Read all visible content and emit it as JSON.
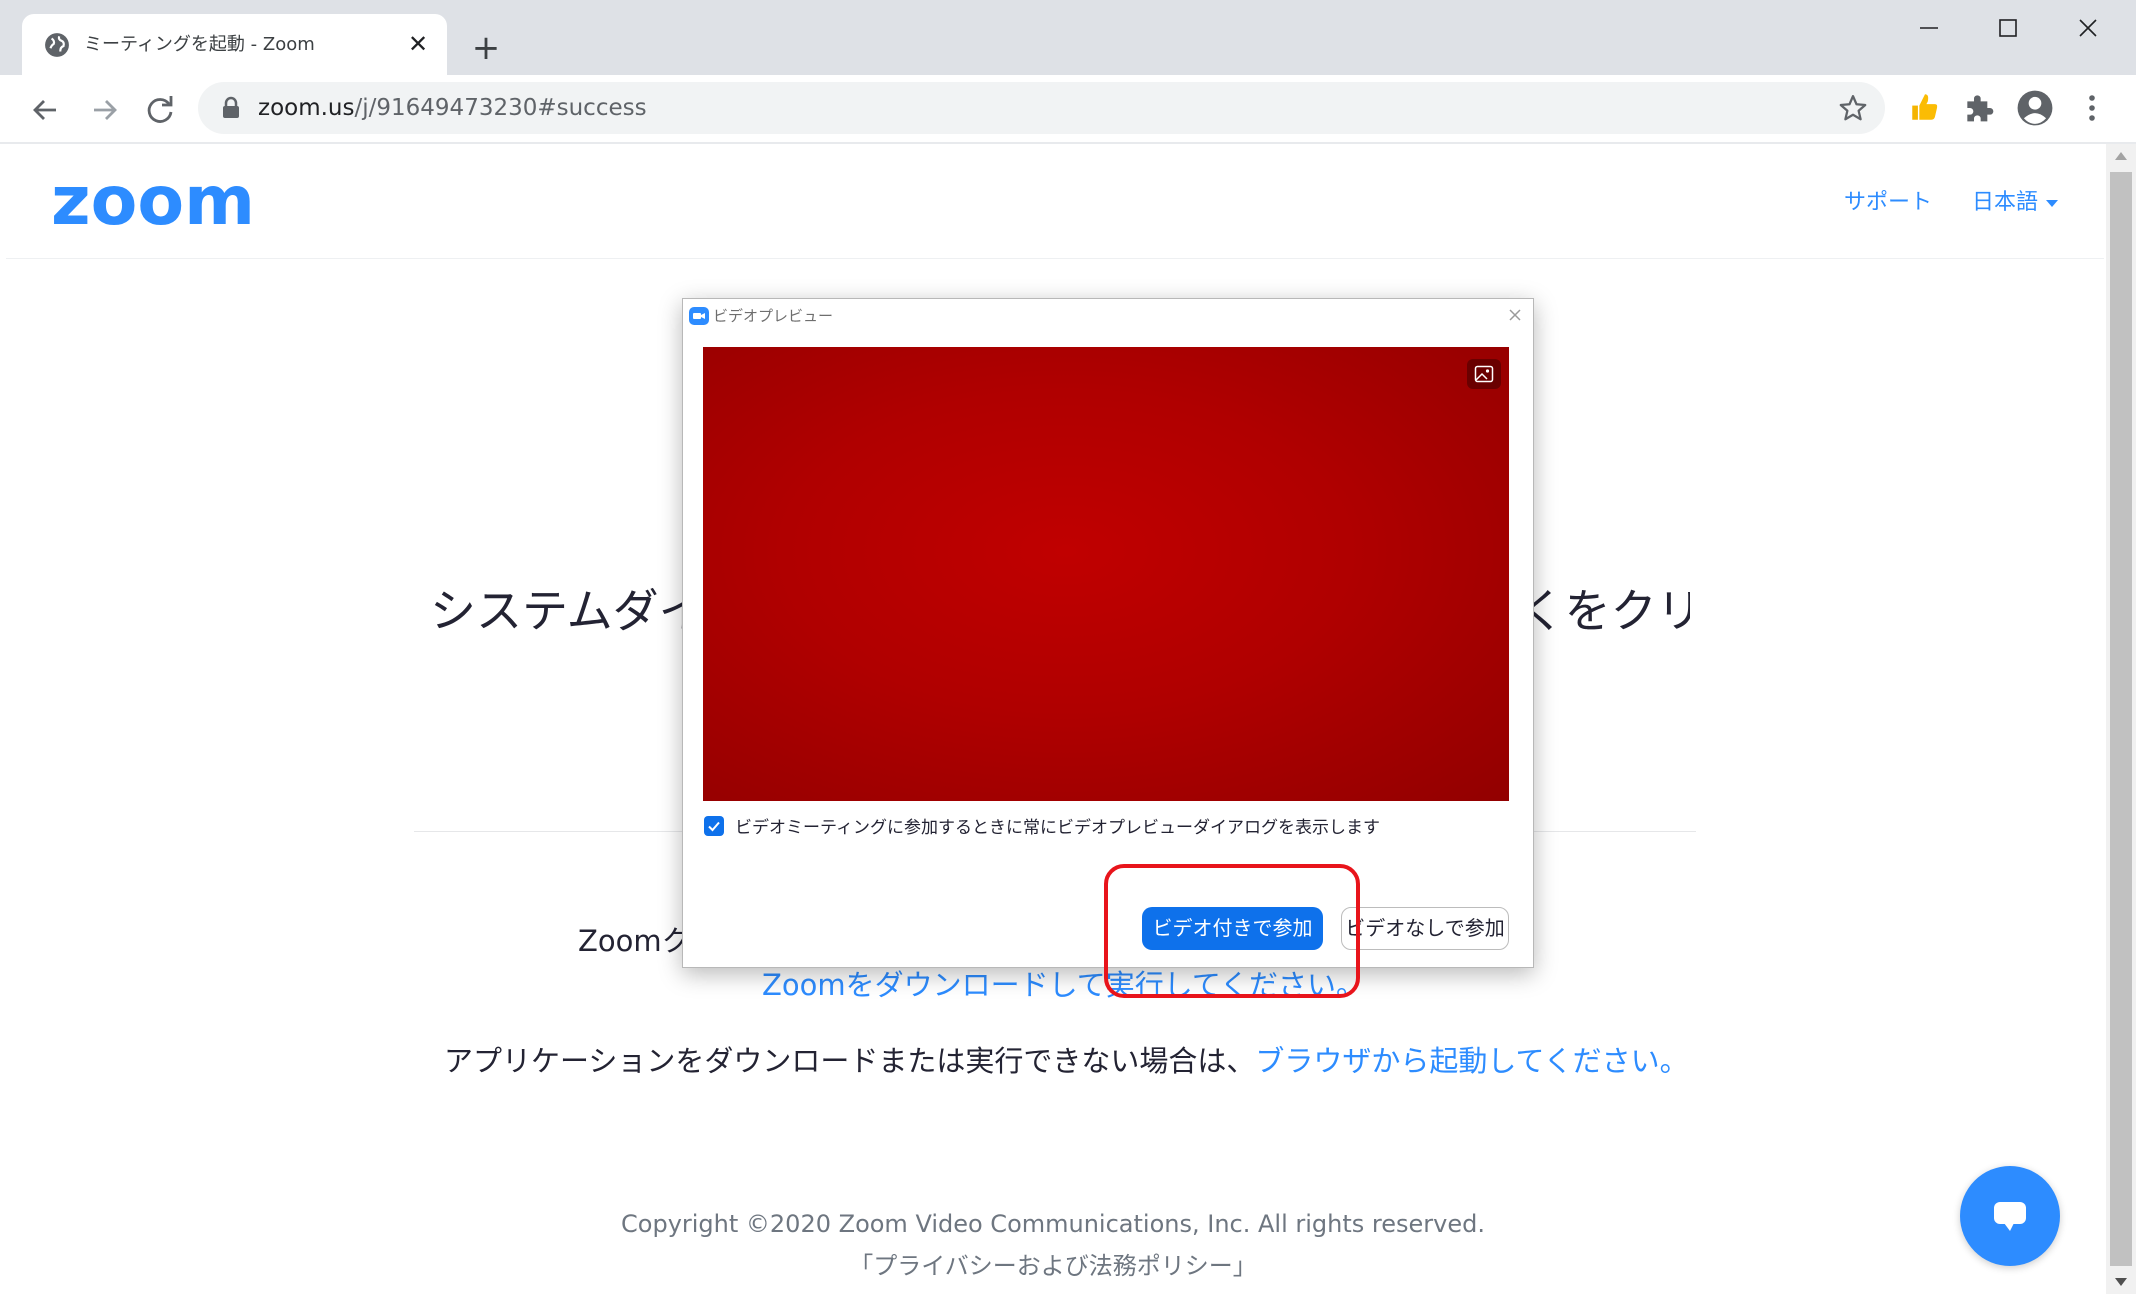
{
  "browser": {
    "tab_title": "ミーティングを起動 - Zoom",
    "url_host": "zoom.us",
    "url_path": "/j/91649473230#success"
  },
  "page": {
    "logo": "zoom",
    "nav_support": "サポート",
    "nav_language": "日本語",
    "headline_left": "システムダイ",
    "headline_right": "くをクリ",
    "client_text": "Zoomク",
    "download_link": "Zoomをダウンロードして実行してください。",
    "browser_prefix": "アプリケーションをダウンロードまたは実行できない場合は、",
    "browser_link": "ブラウザから起動してください。",
    "copyright": "Copyright ©2020 Zoom Video Communications, Inc. All rights reserved.",
    "privacy": "「プライバシーおよび法務ポリシー」"
  },
  "dialog": {
    "title": "ビデオプレビュー",
    "checkbox_label": "ビデオミーティングに参加するときに常にビデオプレビューダイアログを表示します",
    "checkbox_checked": true,
    "join_with_video": "ビデオ付きで参加",
    "join_without_video": "ビデオなしで参加"
  },
  "colors": {
    "zoom_blue": "#2d8cff",
    "button_blue": "#0e71eb",
    "video_red": "#b00000",
    "highlight": "#e8141b"
  },
  "icons": [
    "globe-icon",
    "close-icon",
    "plus-icon",
    "minimize-icon",
    "maximize-icon",
    "back-icon",
    "forward-icon",
    "reload-icon",
    "lock-icon",
    "star-icon",
    "thumbs-up-icon",
    "puzzle-icon",
    "profile-icon",
    "kebab-icon",
    "chat-icon",
    "zoom-camera-icon",
    "background-image-icon",
    "checkmark-icon",
    "caret-down-icon"
  ]
}
